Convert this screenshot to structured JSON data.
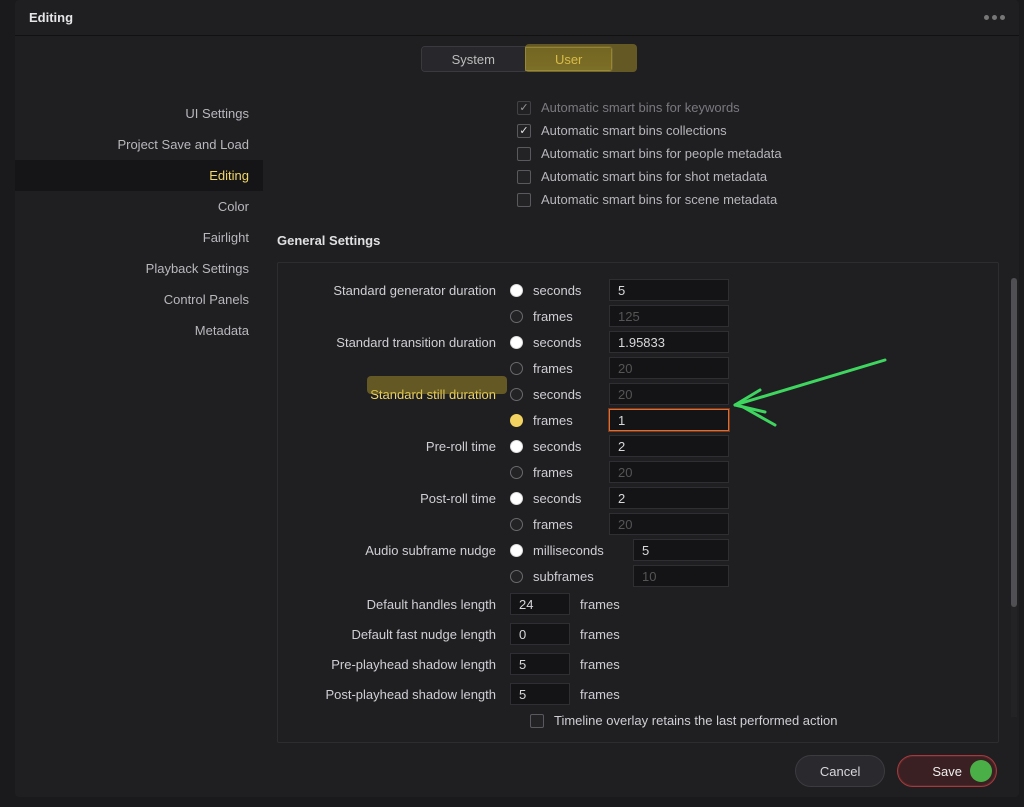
{
  "window_title": "Editing",
  "tabs": {
    "system": "System",
    "user": "User"
  },
  "sidebar": {
    "ui": "UI Settings",
    "save": "Project Save and Load",
    "editing": "Editing",
    "color": "Color",
    "fairlight": "Fairlight",
    "playback": "Playback Settings",
    "control": "Control Panels",
    "metadata": "Metadata"
  },
  "smart_bins": {
    "keywords": "Automatic smart bins for keywords",
    "collections": "Automatic smart bins collections",
    "people": "Automatic smart bins for people metadata",
    "shot": "Automatic smart bins for shot metadata",
    "scene": "Automatic smart bins for scene metadata"
  },
  "section_title": "General Settings",
  "units": {
    "seconds": "seconds",
    "frames": "frames",
    "milliseconds": "milliseconds",
    "subframes": "subframes"
  },
  "rows": {
    "gen": {
      "label": "Standard generator duration",
      "sec": "5",
      "frm": "125"
    },
    "tra": {
      "label": "Standard transition duration",
      "sec": "1.95833",
      "frm": "20"
    },
    "stl": {
      "label": "Standard still duration",
      "sec": "20",
      "frm": "1"
    },
    "pre": {
      "label": "Pre-roll time",
      "sec": "2",
      "frm": "20"
    },
    "post": {
      "label": "Post-roll time",
      "sec": "2",
      "frm": "20"
    },
    "aud": {
      "label": "Audio subframe nudge",
      "ms": "5",
      "sf": "10"
    }
  },
  "simple": {
    "handles": {
      "label": "Default handles length",
      "val": "24"
    },
    "nudge": {
      "label": "Default fast nudge length",
      "val": "0"
    },
    "preshadow": {
      "label": "Pre-playhead shadow length",
      "val": "5"
    },
    "postshadow": {
      "label": "Post-playhead shadow length",
      "val": "5"
    }
  },
  "overlay_line": "Timeline overlay retains the last performed action",
  "buttons": {
    "cancel": "Cancel",
    "save": "Save"
  }
}
